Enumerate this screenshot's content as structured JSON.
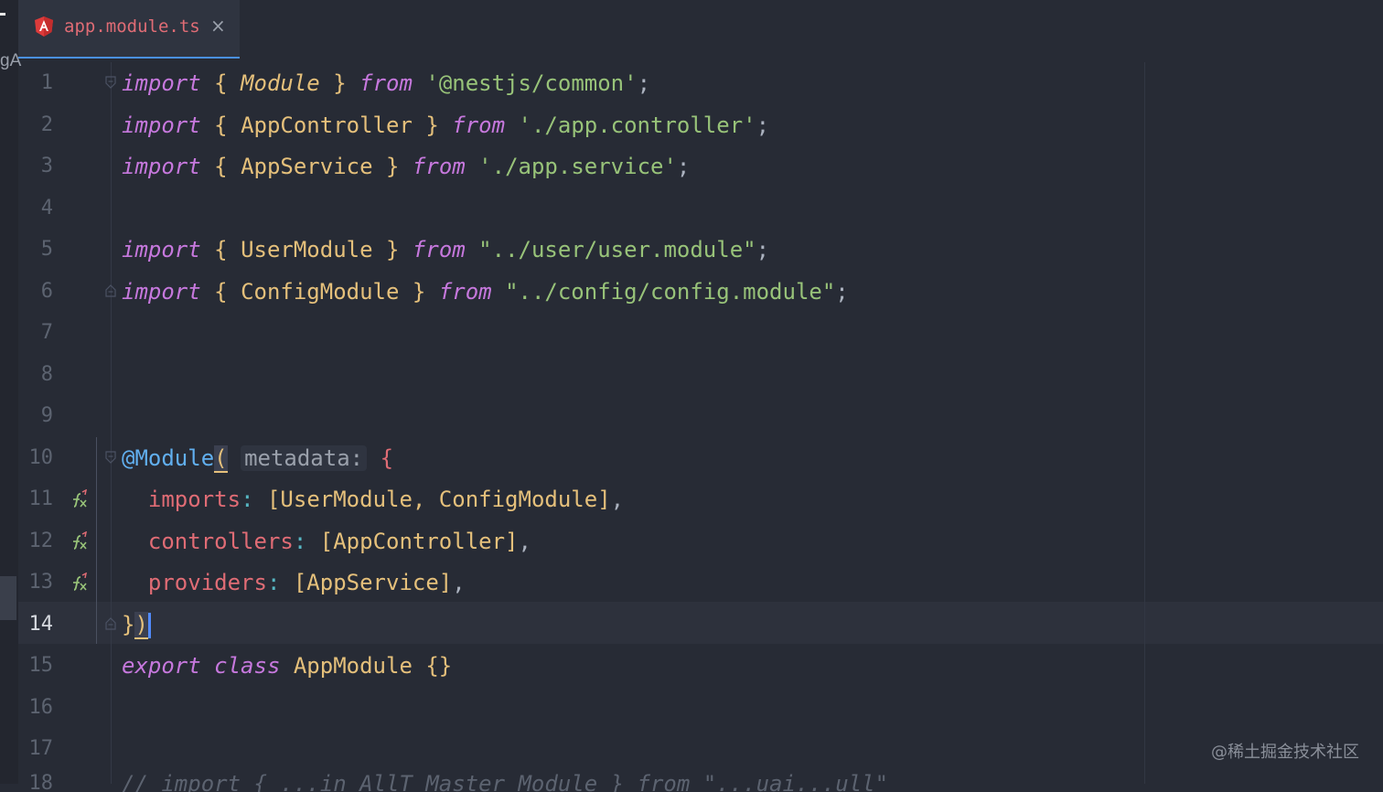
{
  "sidebar": {
    "fragment_text": "gA"
  },
  "tab": {
    "filename": "app.module.ts",
    "close_glyph": "×",
    "icon": "angular-icon"
  },
  "editor": {
    "active_line": 14,
    "lines": [
      {
        "n": "1",
        "t": [
          "import",
          " ",
          "{",
          " ",
          "Module",
          " ",
          "}",
          " ",
          "from",
          " ",
          "'@nestjs/common'",
          ";"
        ]
      },
      {
        "n": "2",
        "t": [
          "import",
          " ",
          "{",
          " ",
          "AppController",
          " ",
          "}",
          " ",
          "from",
          " ",
          "'./app.controller'",
          ";"
        ]
      },
      {
        "n": "3",
        "t": [
          "import",
          " ",
          "{",
          " ",
          "AppService",
          " ",
          "}",
          " ",
          "from",
          " ",
          "'./app.service'",
          ";"
        ]
      },
      {
        "n": "4",
        "t": []
      },
      {
        "n": "5",
        "t": [
          "import",
          " ",
          "{",
          " ",
          "UserModule",
          " ",
          "}",
          " ",
          "from",
          " ",
          "\"../user/user.module\"",
          ";"
        ]
      },
      {
        "n": "6",
        "t": [
          "import",
          " ",
          "{",
          " ",
          "ConfigModule",
          " ",
          "}",
          " ",
          "from",
          " ",
          "\"../config/config.module\"",
          ";"
        ]
      },
      {
        "n": "7",
        "t": []
      },
      {
        "n": "8",
        "t": []
      },
      {
        "n": "9",
        "t": []
      },
      {
        "n": "10",
        "t": [
          "@Module",
          "(",
          " ",
          "metadata:",
          " ",
          "{"
        ]
      },
      {
        "n": "11",
        "t": [
          "  ",
          "imports",
          ":",
          " ",
          "[UserModule, ConfigModule]",
          ","
        ]
      },
      {
        "n": "12",
        "t": [
          "  ",
          "controllers",
          ":",
          " ",
          "[AppController]",
          ","
        ]
      },
      {
        "n": "13",
        "t": [
          "  ",
          "providers",
          ":",
          " ",
          "[AppService]",
          ","
        ]
      },
      {
        "n": "14",
        "t": [
          "}",
          ")"
        ]
      },
      {
        "n": "15",
        "t": [
          "export",
          " ",
          "class",
          " ",
          "AppModule",
          " ",
          "{}"
        ]
      },
      {
        "n": "16",
        "t": []
      },
      {
        "n": "17",
        "t": []
      }
    ],
    "partial_line": {
      "n": "18",
      "text": "// import { ...in AllT Master Module } from \"...uai...ull\""
    }
  },
  "gutter_icon": "fx-recursive-icon",
  "watermark": "@稀土掘金技术社区",
  "colors": {
    "background": "#272b35",
    "keyword": "#c678dd",
    "string": "#98c379",
    "type": "#e5c07b",
    "property": "#e06c75",
    "decorator": "#61afef",
    "tab_accent": "#4a90e2"
  }
}
